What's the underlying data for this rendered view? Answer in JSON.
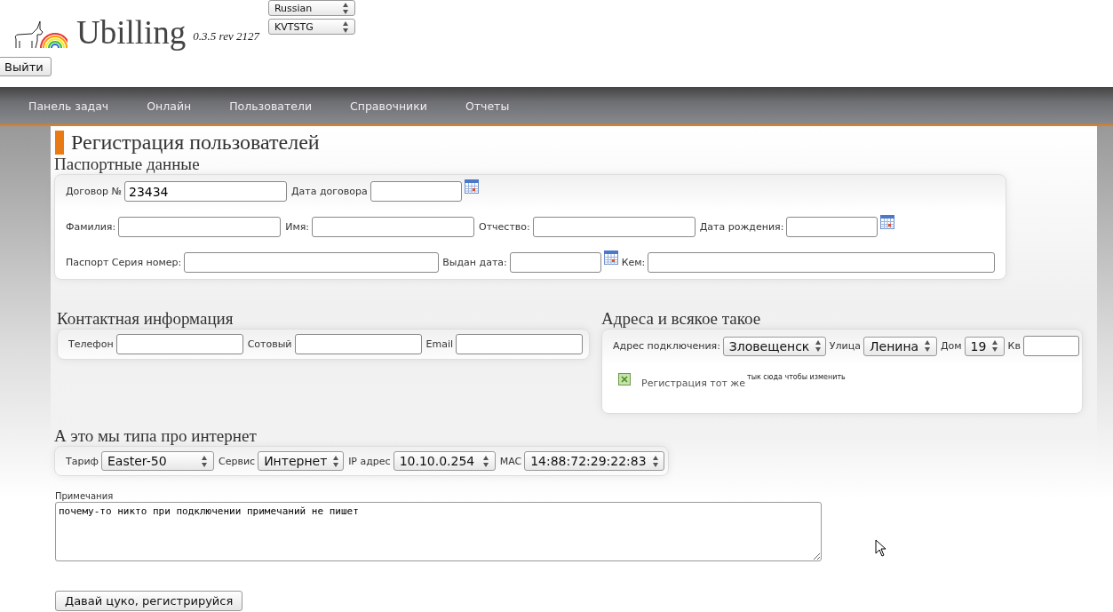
{
  "header": {
    "logo_text": "Ubilling",
    "version": "0.3.5 rev 2127",
    "selects": [
      {
        "value": "Russian"
      },
      {
        "value": "KVTSTG"
      }
    ],
    "logout_button": "Выйти"
  },
  "nav": [
    {
      "label": "Панель задач"
    },
    {
      "label": "Онлайн"
    },
    {
      "label": "Пользователи"
    },
    {
      "label": "Справочники"
    },
    {
      "label": "Отчеты"
    }
  ],
  "page_title": "Регистрация пользователей",
  "passport": {
    "title": "Паспортные данные",
    "rows": [
      [
        {
          "kind": "text",
          "label": "Договор №",
          "value": "23434"
        },
        {
          "kind": "date",
          "label": "Дата договора"
        }
      ],
      [
        {
          "kind": "text",
          "label": "Фамилия:"
        },
        {
          "kind": "text",
          "label": "Имя:"
        },
        {
          "kind": "text",
          "label": "Отчество:"
        },
        {
          "kind": "date",
          "label": "Дата рождения:"
        }
      ],
      [
        {
          "kind": "text",
          "label": "Паспорт Серия номер:"
        },
        {
          "kind": "date",
          "label": "Выдан дата:"
        },
        {
          "kind": "text",
          "label": "Кем:"
        }
      ]
    ]
  },
  "contact": {
    "title": "Контактная информация",
    "fields": [
      {
        "kind": "text",
        "label": "Телефон"
      },
      {
        "kind": "text",
        "label": "Сотовый"
      },
      {
        "kind": "text",
        "label": "Email"
      }
    ]
  },
  "address": {
    "title": "Адреса и всякое такое",
    "fields": [
      {
        "kind": "select",
        "label": "Адрес подключения:",
        "value": "Зловещенск"
      },
      {
        "kind": "select",
        "label": "Улица",
        "value": "Ленина"
      },
      {
        "kind": "select",
        "label": "Дом",
        "value": "19"
      },
      {
        "kind": "text",
        "label": "Кв"
      }
    ],
    "registration": {
      "label": "Регистрация тот же",
      "checked": true,
      "hint": "тык сюда чтобы изменить"
    }
  },
  "internet": {
    "title": "А это мы типа про интернет",
    "fields": [
      {
        "kind": "select",
        "label": "Тариф",
        "value": "Easter-50"
      },
      {
        "kind": "select",
        "label": "Сервис",
        "value": "Интернет"
      },
      {
        "kind": "select",
        "label": "IP адрес",
        "value": "10.10.0.254"
      },
      {
        "kind": "select",
        "label": "MAC",
        "value": "14:88:72:29:22:83"
      }
    ]
  },
  "notes": {
    "label": "Примечания",
    "value": "почему-то никто при подключении примечаний не пишет"
  },
  "submit_button": "Давай цуко, регистрируйся"
}
